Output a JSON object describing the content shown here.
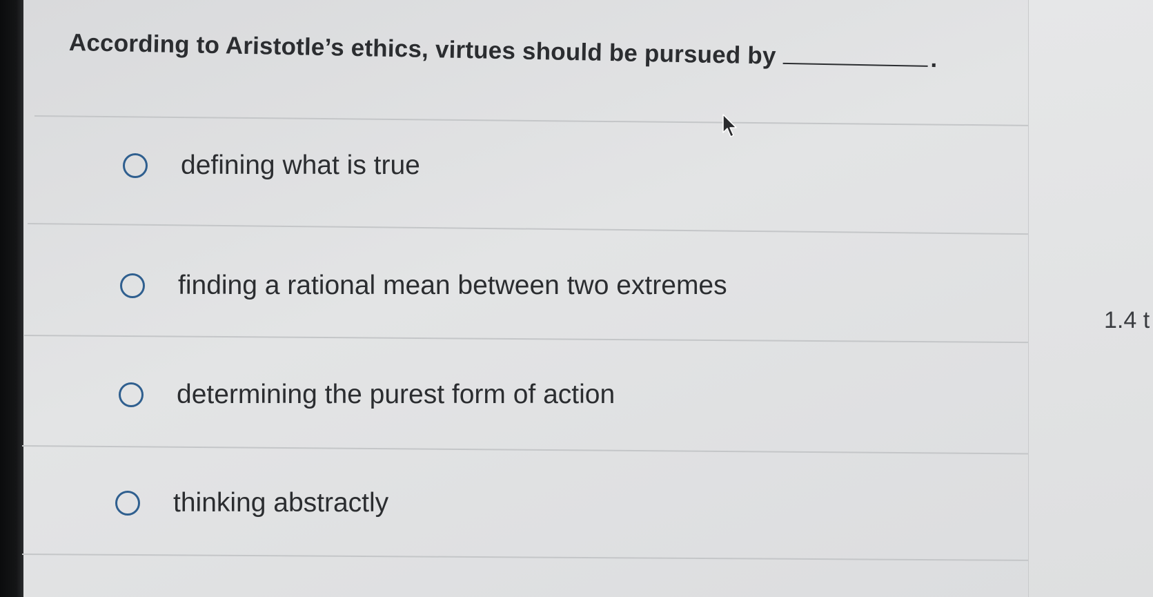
{
  "question": {
    "text": "According to Aristotle’s ethics, virtues should be pursued by",
    "period": "."
  },
  "options": [
    {
      "label": "defining what is true",
      "selected": false
    },
    {
      "label": "finding a rational mean between two extremes",
      "selected": false
    },
    {
      "label": "determining the purest form of action",
      "selected": false
    },
    {
      "label": "thinking abstractly",
      "selected": false
    }
  ],
  "side_panel": {
    "partial_text": "1.4 t"
  },
  "icons": {
    "cursor": "mouse-pointer-arrow",
    "radio": "radio-button-empty-circle"
  },
  "colors": {
    "radio_outline": "#2f5f8f",
    "text": "#2b2d30",
    "panel_background": "#e1e2e3"
  }
}
